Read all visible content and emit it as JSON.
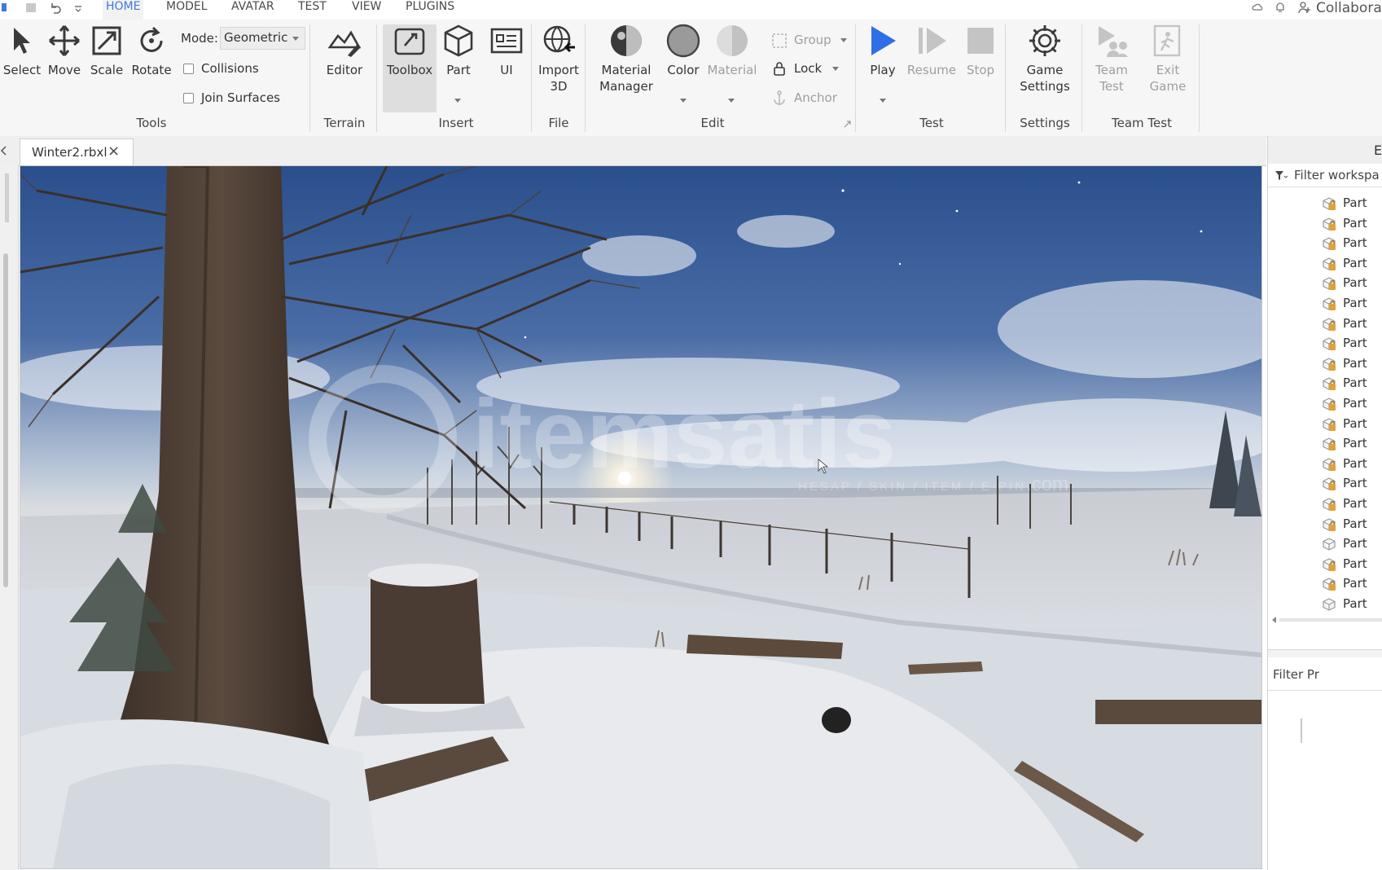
{
  "menu": {
    "tabs": [
      {
        "label": "HOME",
        "active": true
      },
      {
        "label": "MODEL"
      },
      {
        "label": "AVATAR"
      },
      {
        "label": "TEST"
      },
      {
        "label": "VIEW"
      },
      {
        "label": "PLUGINS"
      }
    ],
    "collaborate_label": "Collabora"
  },
  "ribbon": {
    "tools": {
      "select": "Select",
      "move": "Move",
      "scale": "Scale",
      "rotate": "Rotate",
      "mode_label": "Mode:",
      "mode_value": "Geometric",
      "collisions": "Collisions",
      "join_surfaces": "Join Surfaces",
      "group_label": "Tools"
    },
    "terrain": {
      "editor": "Editor",
      "group_label": "Terrain"
    },
    "insert": {
      "toolbox": "Toolbox",
      "part": "Part",
      "ui": "UI",
      "group_label": "Insert"
    },
    "file": {
      "import_line1": "Import",
      "import_line2": "3D",
      "group_label": "File"
    },
    "edit": {
      "material_manager_line1": "Material",
      "material_manager_line2": "Manager",
      "color": "Color",
      "material": "Material",
      "group": "Group",
      "lock": "Lock",
      "anchor": "Anchor",
      "group_label": "Edit"
    },
    "test": {
      "play": "Play",
      "resume": "Resume",
      "stop": "Stop",
      "group_label": "Test"
    },
    "settings": {
      "line1": "Game",
      "line2": "Settings",
      "group_label": "Settings"
    },
    "team_test": {
      "team_line1": "Team",
      "team_line2": "Test",
      "exit_line1": "Exit",
      "exit_line2": "Game",
      "group_label": "Team Test"
    }
  },
  "document_tab": {
    "title": "Winter2.rbxl",
    "close": "×"
  },
  "viewport": {
    "watermark_text": "itemsatis",
    "watermark_sub": "HESAP / SKIN / ITEM / E-PIN",
    "watermark_com": ".com"
  },
  "explorer": {
    "header_label": "E",
    "filter_placeholder": "Filter workspa",
    "items": [
      {
        "label": "Part",
        "icon": "anchored-part-icon"
      },
      {
        "label": "Part",
        "icon": "anchored-part-icon"
      },
      {
        "label": "Part",
        "icon": "anchored-part-icon"
      },
      {
        "label": "Part",
        "icon": "anchored-part-icon"
      },
      {
        "label": "Part",
        "icon": "anchored-part-icon"
      },
      {
        "label": "Part",
        "icon": "anchored-part-icon"
      },
      {
        "label": "Part",
        "icon": "anchored-part-icon"
      },
      {
        "label": "Part",
        "icon": "anchored-part-icon"
      },
      {
        "label": "Part",
        "icon": "anchored-part-icon"
      },
      {
        "label": "Part",
        "icon": "anchored-part-icon"
      },
      {
        "label": "Part",
        "icon": "anchored-part-icon"
      },
      {
        "label": "Part",
        "icon": "anchored-part-icon"
      },
      {
        "label": "Part",
        "icon": "anchored-part-icon"
      },
      {
        "label": "Part",
        "icon": "anchored-part-icon"
      },
      {
        "label": "Part",
        "icon": "anchored-part-icon"
      },
      {
        "label": "Part",
        "icon": "anchored-part-icon"
      },
      {
        "label": "Part",
        "icon": "anchored-part-icon"
      },
      {
        "label": "Part",
        "icon": "part-icon"
      },
      {
        "label": "Part",
        "icon": "anchored-part-icon"
      },
      {
        "label": "Part",
        "icon": "anchored-part-icon"
      },
      {
        "label": "Part",
        "icon": "part-icon"
      }
    ]
  },
  "properties": {
    "filter_placeholder": "Filter Pr"
  },
  "colors": {
    "accent": "#3d7bd6",
    "play": "#2f6ee8",
    "ribbon_bg": "#f6f6f6"
  }
}
